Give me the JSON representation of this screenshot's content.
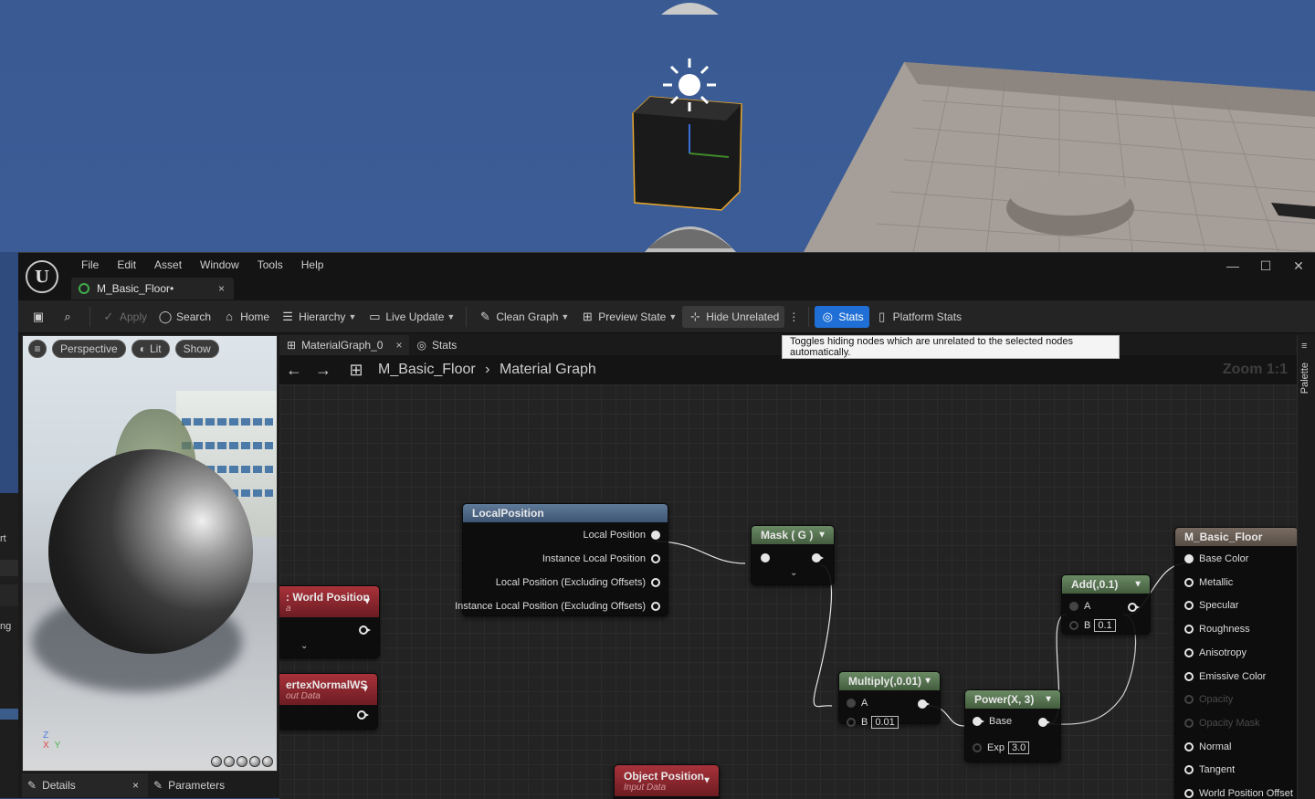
{
  "menu": [
    "File",
    "Edit",
    "Asset",
    "Window",
    "Tools",
    "Help"
  ],
  "document_tab": {
    "label": "M_Basic_Floor•",
    "close": "×"
  },
  "window_controls": {
    "minimize": "—",
    "maximize": "☐",
    "close": "✕"
  },
  "toolbar": {
    "apply": "Apply",
    "search": "Search",
    "home": "Home",
    "hierarchy": "Hierarchy",
    "live_update": "Live Update",
    "clean_graph": "Clean Graph",
    "preview_state": "Preview State",
    "hide_unrelated": "Hide Unrelated",
    "stats": "Stats",
    "platform_stats": "Platform Stats"
  },
  "tooltip": "Toggles hiding nodes which are unrelated to the selected nodes automatically.",
  "viewport": {
    "perspective": "Perspective",
    "lit": "Lit",
    "show": "Show",
    "axis_z": "Z",
    "axis_x": "X",
    "axis_y": "Y"
  },
  "bottom_tabs": {
    "details": "Details",
    "details_close": "×",
    "parameters": "Parameters"
  },
  "graph_tabs": {
    "graph": "MaterialGraph_0",
    "graph_close": "×",
    "stats": "Stats"
  },
  "breadcrumb": {
    "asset": "M_Basic_Floor",
    "sep": "›",
    "graph": "Material Graph",
    "zoom": "Zoom 1:1"
  },
  "palette": "Palette",
  "nodes": {
    "local_position": {
      "title": "LocalPosition",
      "pins": [
        "Local Position",
        "Instance Local Position",
        "Local Position (Excluding Offsets)",
        "Instance Local Position (Excluding Offsets)"
      ]
    },
    "world_position": {
      "title": ": World Position",
      "sub": "a"
    },
    "vertex_normal": {
      "title": "ertexNormalWS",
      "sub": "out Data"
    },
    "object_position": {
      "title": "Object Position",
      "sub": "Input Data"
    },
    "mask": {
      "title": "Mask ( G )"
    },
    "multiply": {
      "title": "Multiply(,0.01)",
      "a": "A",
      "b": "B",
      "b_val": "0.01"
    },
    "power": {
      "title": "Power(X, 3)",
      "base": "Base",
      "exp": "Exp",
      "exp_val": "3.0"
    },
    "add": {
      "title": "Add(,0.1)",
      "a": "A",
      "b": "B",
      "b_val": "0.1"
    },
    "material": {
      "title": "M_Basic_Floor",
      "pins": [
        "Base Color",
        "Metallic",
        "Specular",
        "Roughness",
        "Anisotropy",
        "Emissive Color",
        "Opacity",
        "Opacity Mask",
        "Normal",
        "Tangent",
        "World Position Offset"
      ],
      "dim": [
        false,
        false,
        false,
        false,
        false,
        false,
        true,
        true,
        false,
        false,
        false
      ]
    }
  },
  "left_strip": {
    "t1": "rt",
    "t2": "ng"
  }
}
